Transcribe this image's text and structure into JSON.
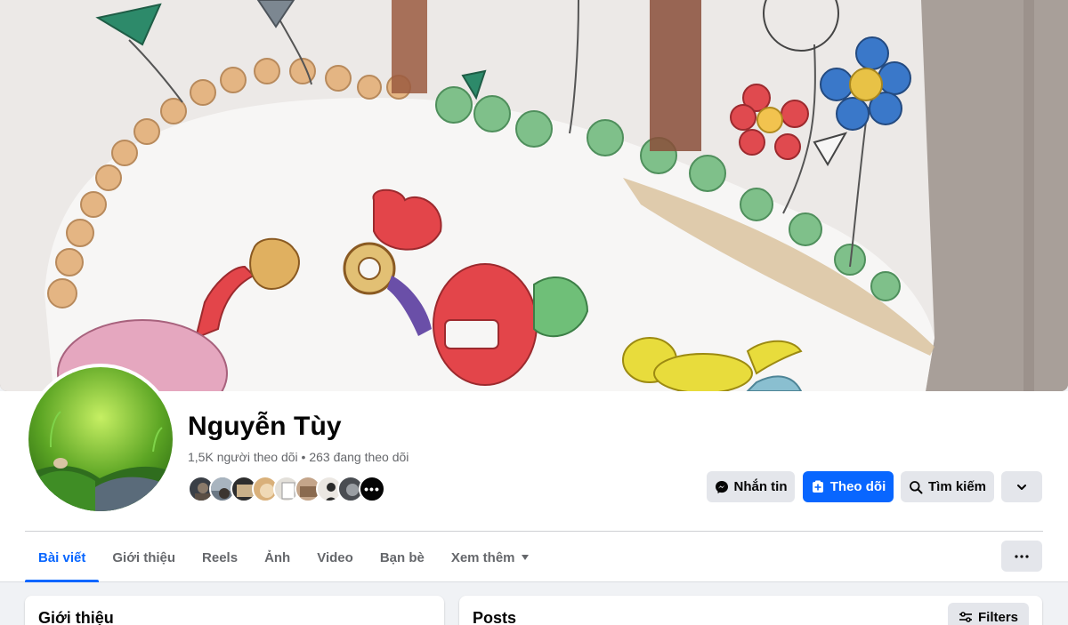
{
  "profile": {
    "name": "Nguyễn Tùy",
    "stats": "1,5K người theo dõi • 263 đang theo dõi",
    "followers_more": "•••"
  },
  "actions": {
    "message_label": "Nhắn tin",
    "follow_label": "Theo dõi",
    "search_label": "Tìm kiếm"
  },
  "tabs": [
    {
      "label": "Bài viết",
      "active": true
    },
    {
      "label": "Giới thiệu"
    },
    {
      "label": "Reels"
    },
    {
      "label": "Ảnh"
    },
    {
      "label": "Video"
    },
    {
      "label": "Bạn bè"
    },
    {
      "label": "Xem thêm"
    }
  ],
  "intro_card": {
    "title": "Giới thiệu"
  },
  "posts_card": {
    "title": "Posts",
    "filters_label": "Filters"
  },
  "colors": {
    "accent": "#0866ff",
    "secondary_text": "#65676b",
    "button_grey": "#e4e6eb"
  },
  "icons": [
    "messenger-icon",
    "follow-plus-icon",
    "search-icon",
    "chevron-down-icon",
    "ellipsis-icon",
    "filters-icon",
    "caret-down-icon"
  ]
}
